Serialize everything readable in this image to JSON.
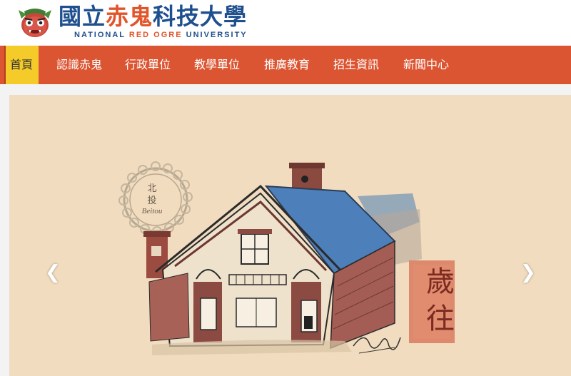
{
  "brand": {
    "title_part1": "國立",
    "title_part2": "赤鬼",
    "title_part3": "科技大學",
    "subtitle_part1": "NATIONAL ",
    "subtitle_part2": "RED OGRE",
    "subtitle_part3": " UNIVERSITY",
    "colors": {
      "blue": "#1e4f8e",
      "red": "#e2542a"
    }
  },
  "nav": {
    "items": [
      {
        "label": "首頁",
        "active": true
      },
      {
        "label": "認識赤鬼"
      },
      {
        "label": "行政單位"
      },
      {
        "label": "教學單位"
      },
      {
        "label": "推廣教育"
      },
      {
        "label": "招生資訊"
      },
      {
        "label": "新聞中心"
      }
    ],
    "colors": {
      "bar": "#dc5532",
      "active": "#f5cb2a"
    }
  },
  "banner": {
    "prev_icon": "chevron-left-icon",
    "next_icon": "chevron-right-icon",
    "prev_glyph": "❮",
    "next_glyph": "❯",
    "stamp_line1": "歲",
    "stamp_line2": "往",
    "seal_line1": "北",
    "seal_line2": "投",
    "seal_line3": "Beitou",
    "signature": "Lucy"
  }
}
